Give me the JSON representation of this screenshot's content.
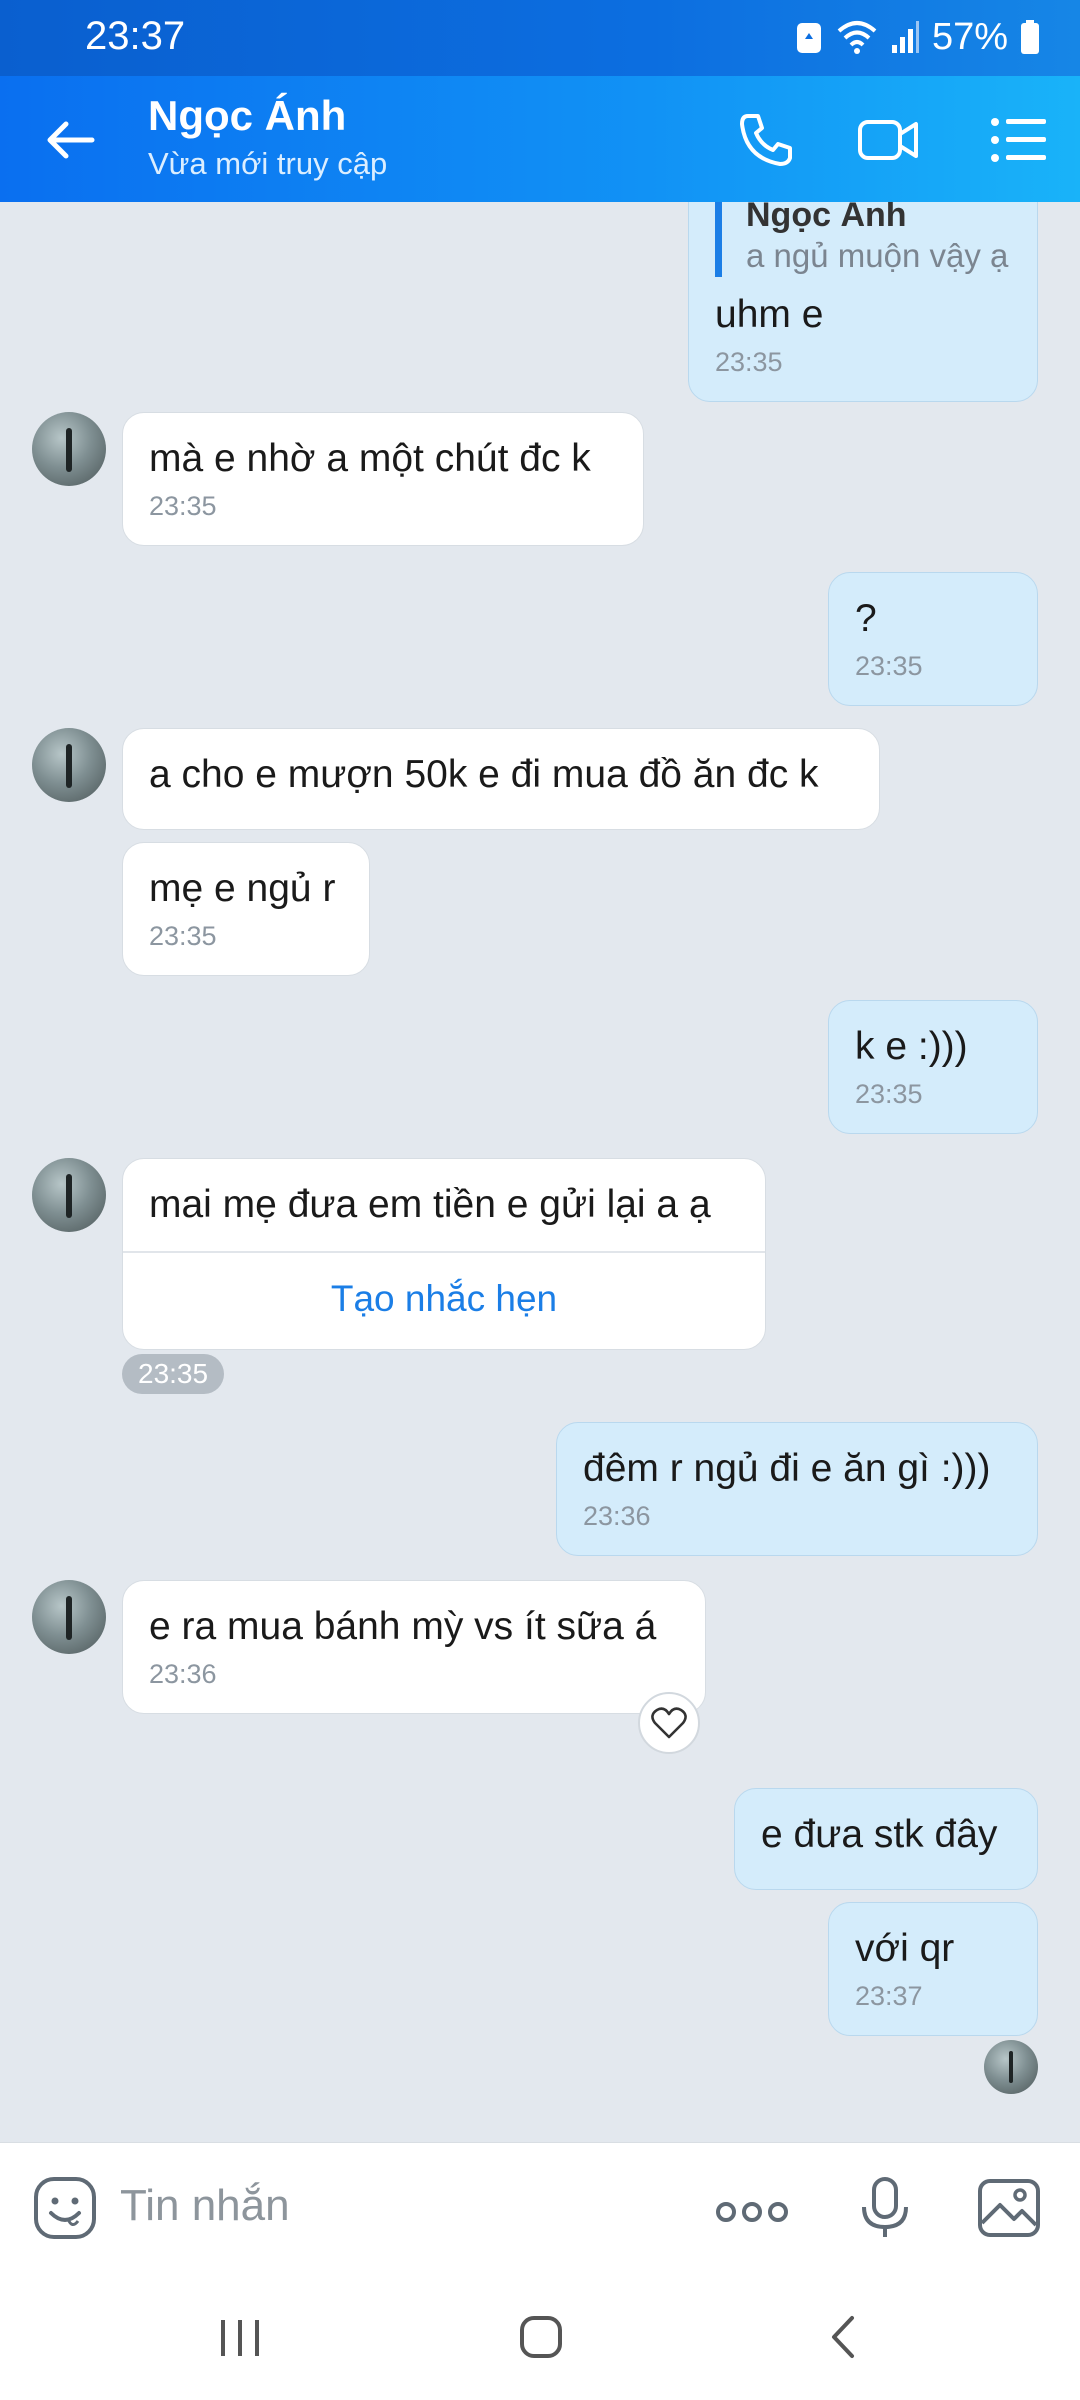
{
  "status_bar": {
    "time": "23:37",
    "battery": "57%"
  },
  "header": {
    "name": "Ngọc Ánh",
    "status": "Vừa mới truy cập"
  },
  "messages": {
    "m0": {
      "quote_name": "Ngọc Ánh",
      "quote_text": "a ngủ muộn vậy ạ",
      "text": "uhm e",
      "time": "23:35"
    },
    "m1": {
      "text": "mà e nhờ a một chút đc k",
      "time": "23:35"
    },
    "m2": {
      "text": "?",
      "time": "23:35"
    },
    "m3": {
      "text": "a cho e mượn 50k e đi mua đồ ăn đc k"
    },
    "m4": {
      "text": "mẹ e ngủ r",
      "time": "23:35"
    },
    "m5": {
      "text": "k e :)))",
      "time": "23:35"
    },
    "m6": {
      "text": "mai mẹ đưa em tiền e gửi lại a ạ",
      "action": "Tạo nhắc hẹn",
      "time": "23:35"
    },
    "m7": {
      "text": "đêm r ngủ đi e ăn gì :)))",
      "time": "23:36"
    },
    "m8": {
      "text": "e ra mua bánh mỳ vs ít sữa á",
      "time": "23:36"
    },
    "m9": {
      "text": "e đưa stk đây"
    },
    "m10": {
      "text": "với qr",
      "time": "23:37"
    }
  },
  "input": {
    "placeholder": "Tin nhắn"
  },
  "icons": {
    "back": "arrow-left-icon",
    "call": "phone-icon",
    "video": "video-camera-icon",
    "options": "list-icon",
    "emoji": "emoji-icon",
    "more": "more-dots-icon",
    "mic": "microphone-icon",
    "image": "image-icon",
    "heart": "heart-icon"
  },
  "colors": {
    "header": "#0a6ff0",
    "outgoing_bubble": "#d4ecfb",
    "incoming_bubble": "#ffffff",
    "accent": "#1b7ee6",
    "background": "#e3e8ee"
  }
}
